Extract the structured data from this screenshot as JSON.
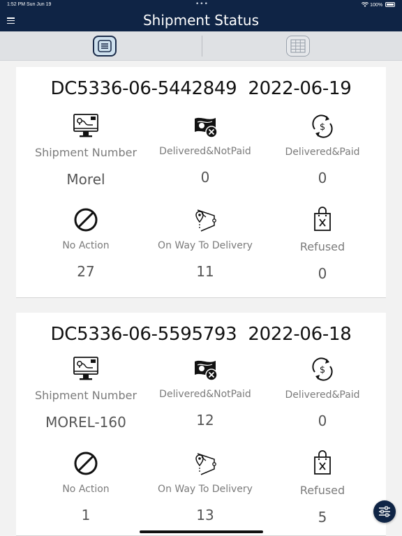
{
  "status_bar": {
    "time_date": "1:52 PM  Sun Jun 19",
    "battery": "100%"
  },
  "header": {
    "title": "Shipment Status"
  },
  "tabs": [
    {
      "name": "list-view"
    },
    {
      "name": "grid-view"
    }
  ],
  "cards": [
    {
      "heading": "DC5336-06-5442849  2022-06-19",
      "row1": [
        {
          "label": "Shipment Number",
          "value": "Morel",
          "icon": "monitor-route-icon"
        },
        {
          "label": "Delivered&NotPaid",
          "value": "0",
          "icon": "cash-cancel-icon"
        },
        {
          "label": "Delivered&Paid",
          "value": "0",
          "icon": "dollar-cycle-icon"
        }
      ],
      "row2": [
        {
          "label": "No Action",
          "value": "27",
          "icon": "prohibited-icon"
        },
        {
          "label": "On Way To Delivery",
          "value": "11",
          "icon": "route-box-icon"
        },
        {
          "label": "Refused",
          "value": "0",
          "icon": "bag-x-icon"
        }
      ]
    },
    {
      "heading": "DC5336-06-5595793  2022-06-18",
      "row1": [
        {
          "label": "Shipment Number",
          "value": "MOREL-160",
          "icon": "monitor-route-icon"
        },
        {
          "label": "Delivered&NotPaid",
          "value": "12",
          "icon": "cash-cancel-icon"
        },
        {
          "label": "Delivered&Paid",
          "value": "0",
          "icon": "dollar-cycle-icon"
        }
      ],
      "row2": [
        {
          "label": "No Action",
          "value": "1",
          "icon": "prohibited-icon"
        },
        {
          "label": "On Way To Delivery",
          "value": "13",
          "icon": "route-box-icon"
        },
        {
          "label": "Refused",
          "value": "5",
          "icon": "bag-x-icon"
        }
      ]
    }
  ],
  "colors": {
    "header_bg": "#0f2445",
    "tab_bg": "#dfe1e4",
    "card_bg": "#ffffff",
    "label": "#7b7b7b"
  }
}
